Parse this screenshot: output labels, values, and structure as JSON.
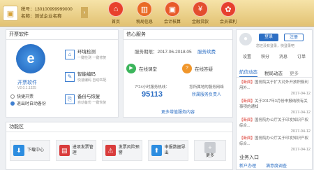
{
  "account": {
    "number_label": "税号：130100999999000",
    "name_label": "名称：测试企业名称",
    "toggle": "›"
  },
  "nav": [
    {
      "label": "首页",
      "icon": "home-icon",
      "color": "#e8412c",
      "glyph": "⌂"
    },
    {
      "label": "税局信息",
      "icon": "bank-icon",
      "color": "#e96a25",
      "glyph": "▥"
    },
    {
      "label": "会计核算",
      "icon": "briefcase-icon",
      "color": "#e85a2a",
      "glyph": "▣"
    },
    {
      "label": "金融贷款",
      "icon": "money-icon",
      "color": "#e34d2e",
      "glyph": "¥"
    },
    {
      "label": "会员福利",
      "icon": "gift-icon",
      "color": "#e6402e",
      "glyph": "✿"
    }
  ],
  "kpjt": {
    "title": "开票软件",
    "app_name": "开票软件",
    "version": "V2.0.1.1325",
    "quick_option": "快捷开票",
    "exit_option": "退出时自动备份",
    "tools": [
      {
        "title": "环境检测",
        "sub": "一键检测 一键修复",
        "glyph": "⌂"
      },
      {
        "title": "智能编码",
        "sub": "快速编码 自动匹配",
        "glyph": "✎"
      },
      {
        "title": "备份与恢复",
        "sub": "自动备份 一键恢复",
        "glyph": "⎘"
      }
    ]
  },
  "service": {
    "title": "信心服务",
    "period": "服务期限：2017.06-2018.05",
    "renew_link": "服务续费",
    "online_class": "在线课堂",
    "online_ask": "在线答疑",
    "hotline_label": "7*24小时服务热线：",
    "hotline": "95113",
    "local_label": "您所属地的服务网络",
    "local_link": "所属服务负责人",
    "more_link": "更多增值服务内容"
  },
  "gongneng": {
    "title": "功能区",
    "cards": [
      {
        "label": "下载中心",
        "color": "#2d8de0",
        "glyph": "⬇"
      },
      {
        "label": "进项发票管理",
        "color": "#d93c3c",
        "glyph": "▤"
      },
      {
        "label": "发票风险预警",
        "color": "#d93c3c",
        "glyph": "⚠"
      },
      {
        "label": "申报数据导出",
        "color": "#2d8de0",
        "glyph": "⬆"
      },
      {
        "label": "更多",
        "color": "#c9ccd1",
        "glyph": "+"
      }
    ]
  },
  "user": {
    "greeting": "您还没有登录，快登录吧",
    "login_btn": "登录",
    "register_btn": "注册",
    "links": [
      "设置",
      "积分",
      "消息",
      "订单"
    ]
  },
  "tabs": {
    "items": [
      "航信动态",
      "税局动态",
      "更多"
    ]
  },
  "news": [
    {
      "tag": "【新闻】",
      "text": "国务院关于扩大对外开放积极利用外...",
      "date": "2017-04-12"
    },
    {
      "tag": "【新闻】",
      "text": "关于2017年3月份申报纳税有关事项的通知",
      "date": "2017-04-12"
    },
    {
      "tag": "【新闻】",
      "text": "国务院办公厅关于印发知识产权综合...",
      "date": "2017-04-12"
    },
    {
      "tag": "【新闻】",
      "text": "国务院办公厅关于印发知识产权综合...",
      "date": "2017-04-12"
    }
  ],
  "business": {
    "title": "业务入口",
    "link1": "新户办理",
    "link2": "满意度调查"
  }
}
